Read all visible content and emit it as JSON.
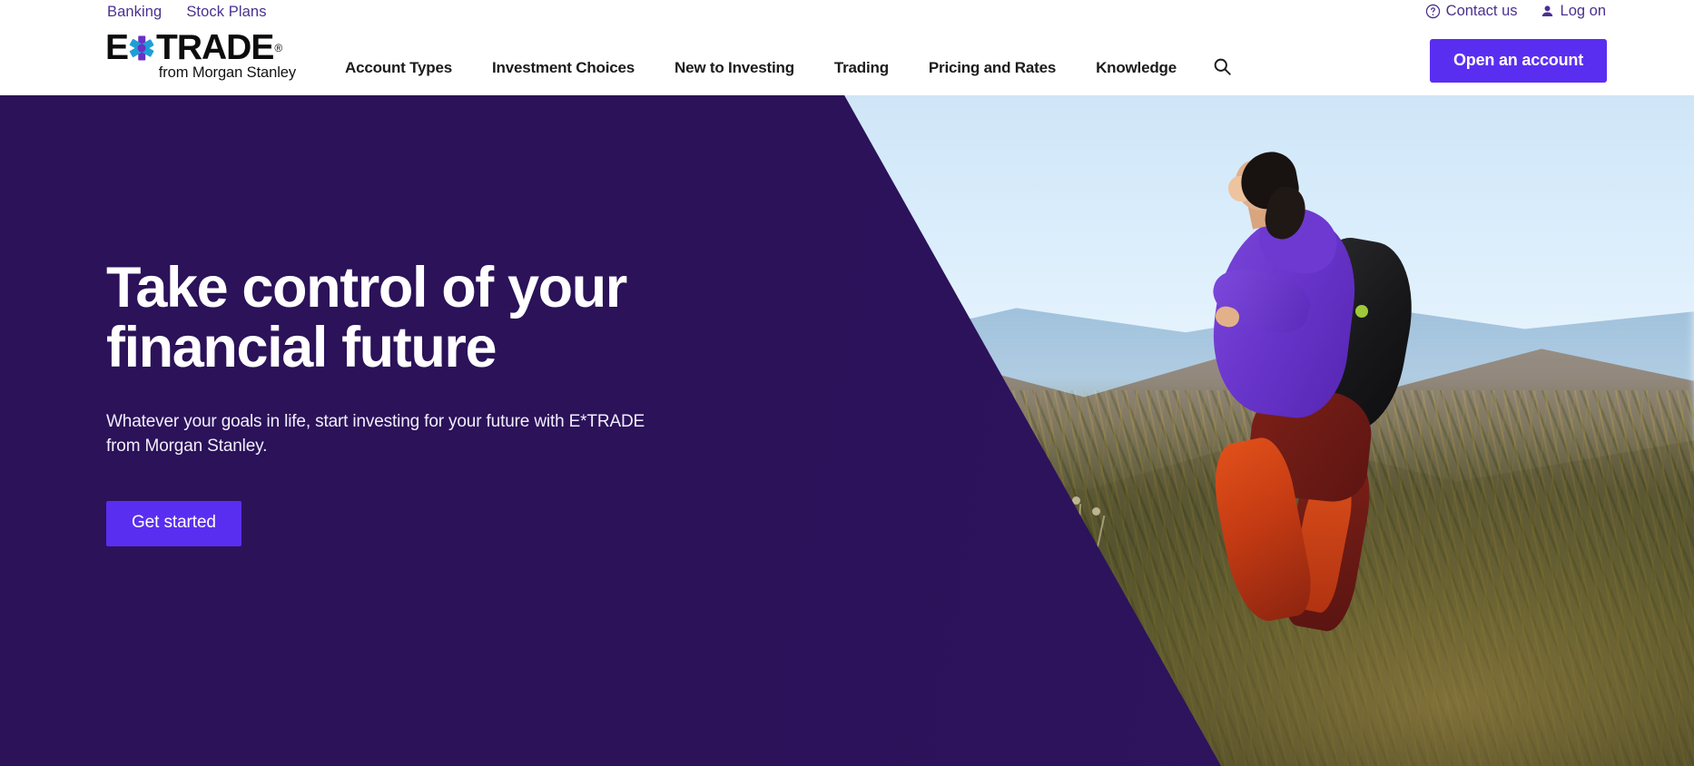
{
  "header": {
    "utility_left": [
      {
        "label": "Banking",
        "icon": "none"
      },
      {
        "label": "Stock Plans",
        "icon": "none"
      }
    ],
    "utility_right": [
      {
        "label": "Contact us",
        "icon": "question-circle-icon"
      },
      {
        "label": "Log on",
        "icon": "person-icon"
      }
    ],
    "logo": {
      "word_left": "E",
      "word_right": "TRADE",
      "trademark": "®",
      "mark": "asterisk-star-icon",
      "tagline": "from Morgan Stanley"
    },
    "nav": [
      {
        "label": "Account Types"
      },
      {
        "label": "Investment Choices"
      },
      {
        "label": "New to Investing"
      },
      {
        "label": "Trading"
      },
      {
        "label": "Pricing and Rates"
      },
      {
        "label": "Knowledge"
      }
    ],
    "search_icon": "search-icon",
    "cta_label": "Open an account"
  },
  "hero": {
    "title_line1": "Take control of your",
    "title_line2": "financial future",
    "subtitle": "Whatever your goals in life, start investing for your future with E*TRADE from Morgan Stanley.",
    "cta_label": "Get started",
    "image_alt": "hiker-walking-uphill-in-mountains"
  },
  "colors": {
    "brand_purple": "#5a2ef0",
    "hero_panel": "#2b1259",
    "link_purple": "#4b3090",
    "nav_text": "#1b1b1b",
    "white": "#ffffff",
    "logo_star_purple": "#6b30c4",
    "logo_star_blue": "#1f9ed6"
  }
}
